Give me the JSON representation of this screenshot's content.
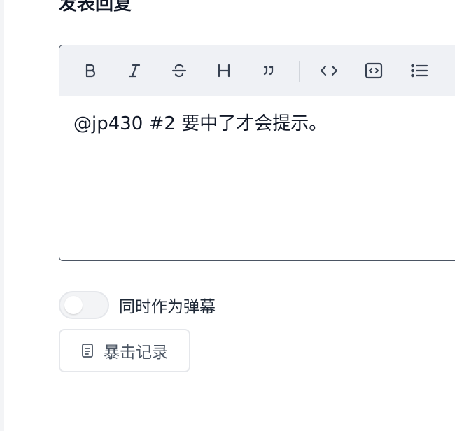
{
  "section": {
    "title": "发表回复"
  },
  "editor": {
    "toolbar": [
      {
        "icon": "bold-icon"
      },
      {
        "icon": "italic-icon"
      },
      {
        "icon": "strikethrough-icon"
      },
      {
        "icon": "heading-icon"
      },
      {
        "icon": "quote-icon"
      },
      {
        "icon": "code-icon"
      },
      {
        "icon": "code-block-icon"
      },
      {
        "icon": "bullet-list-icon"
      },
      {
        "icon": "ordered-list-icon"
      }
    ],
    "content": "@jp430 #2 要中了才会提示。"
  },
  "danmaku_toggle": {
    "label": "同时作为弹幕",
    "on": false
  },
  "history_button": {
    "label": "暴击记录",
    "icon": "document-icon"
  },
  "colors": {
    "editor_border": "#4b5563",
    "toolbar_bg": "#eff1f5",
    "icon": "#374151"
  }
}
